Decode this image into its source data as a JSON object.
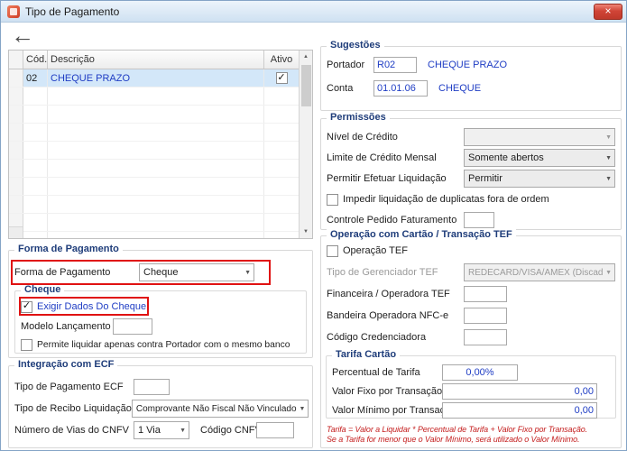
{
  "window": {
    "title": "Tipo de Pagamento",
    "close_icon": "×",
    "back_icon": "←"
  },
  "icons": {
    "combo_arrow": "▼",
    "scroll_up": "▲",
    "scroll_down": "▼",
    "check": "✓"
  },
  "grid": {
    "headers": {
      "cod": "Cód.",
      "descricao": "Descrição",
      "ativo": "Ativo"
    },
    "rows": [
      {
        "cod": "02",
        "descricao": "CHEQUE PRAZO",
        "ativo": true
      }
    ]
  },
  "forma_pagamento": {
    "title": "Forma de Pagamento",
    "label": "Forma de Pagamento",
    "value": "Cheque",
    "cheque": {
      "title": "Cheque",
      "exigir_dados": {
        "label": "Exigir Dados Do Cheque",
        "checked": true
      },
      "modelo_lancamento": {
        "label": "Modelo Lançamento",
        "value": ""
      },
      "permite_liquidar": {
        "label": "Permite liquidar apenas contra Portador com o mesmo banco",
        "checked": false
      }
    }
  },
  "integracao_ecf": {
    "title": "Integração com ECF",
    "tipo_pagamento": {
      "label": "Tipo de Pagamento ECF",
      "value": ""
    },
    "tipo_recibo": {
      "label": "Tipo de Recibo Liquidação",
      "value": "Comprovante Não Fiscal Não Vinculado"
    },
    "numero_vias": {
      "label": "Número de Vias do CNFV",
      "value": "1 Via"
    },
    "codigo_cnfv": {
      "label": "Código CNFV",
      "value": ""
    }
  },
  "sugestoes": {
    "title": "Sugestões",
    "portador": {
      "label": "Portador",
      "value": "R02",
      "descricao": "CHEQUE PRAZO"
    },
    "conta": {
      "label": "Conta",
      "value": "01.01.06",
      "descricao": "CHEQUE"
    }
  },
  "permissoes": {
    "title": "Permissões",
    "nivel_credito": {
      "label": "Nível de Crédito",
      "value": ""
    },
    "limite_credito": {
      "label": "Limite de Crédito Mensal",
      "value": "Somente abertos"
    },
    "permitir_liquidacao": {
      "label": "Permitir Efetuar Liquidação",
      "value": "Permitir"
    },
    "impedir_liquidacao": {
      "label": "Impedir liquidação de duplicatas fora de ordem",
      "checked": false
    },
    "controle_pedido": {
      "label": "Controle Pedido Faturamento",
      "value": ""
    }
  },
  "cartao_tef": {
    "title": "Operação com Cartão / Transação TEF",
    "operacao_tef": {
      "label": "Operação TEF",
      "checked": false
    },
    "gerenciador": {
      "label": "Tipo de Gerenciador TEF",
      "value": "REDECARD/VISA/AMEX (Discado)"
    },
    "financeira": {
      "label": "Financeira / Operadora TEF",
      "value": ""
    },
    "bandeira": {
      "label": "Bandeira Operadora NFC-e",
      "value": ""
    },
    "credenciadora": {
      "label": "Código Credenciadora",
      "value": ""
    },
    "tarifa": {
      "title": "Tarifa Cartão",
      "percentual": {
        "label": "Percentual de Tarifa",
        "value": "0,00%"
      },
      "valor_fixo": {
        "label": "Valor Fixo por Transação",
        "value": "0,00"
      },
      "valor_minimo": {
        "label": "Valor Mínimo por Transação",
        "value": "0,00"
      }
    },
    "nota_linha1": "Tarifa = Valor a Liquidar *  Percentual de Tarifa + Valor Fixo por Transação.",
    "nota_linha2": "Se a Tarifa for menor que o Valor Mínimo, será utilizado o Valor Mínimo."
  },
  "colors": {
    "group_title": "#1f3d7a",
    "value_blue": "#1f3dc4",
    "highlight_red": "#e01212"
  }
}
